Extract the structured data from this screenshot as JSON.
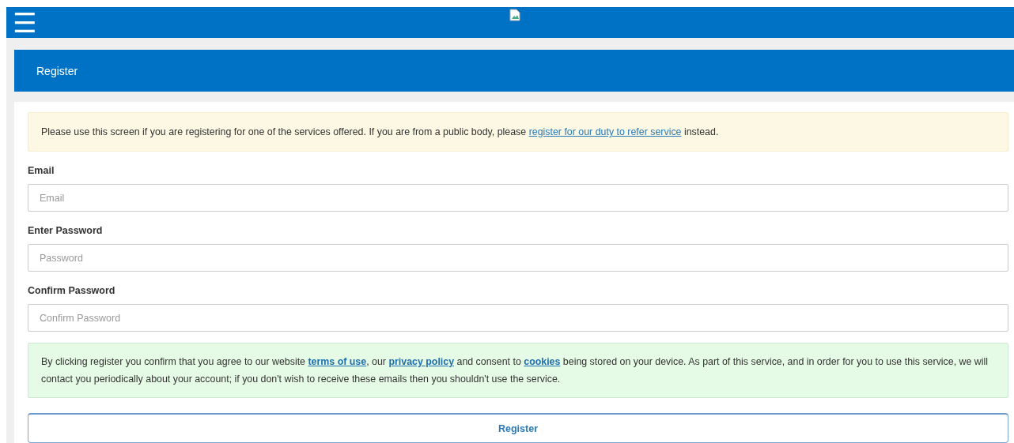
{
  "header": {
    "menu": "☰"
  },
  "panel": {
    "title": "Register"
  },
  "notice": {
    "before": "Please use this screen if you are registering for one of the services offered. If you are from a public body, please ",
    "link": "register for our duty to refer service",
    "after": " instead."
  },
  "fields": [
    {
      "label": "Email",
      "placeholder": "Email"
    },
    {
      "label": "Enter Password",
      "placeholder": "Password"
    },
    {
      "label": "Confirm Password",
      "placeholder": "Confirm Password"
    }
  ],
  "consent": [
    {
      "kind": "text",
      "text": "By clicking register you confirm that you agree to our website "
    },
    {
      "kind": "link",
      "text": "terms of use"
    },
    {
      "kind": "text",
      "text": ", our "
    },
    {
      "kind": "link",
      "text": "privacy policy"
    },
    {
      "kind": "text",
      "text": " and consent to "
    },
    {
      "kind": "link",
      "text": "cookies"
    },
    {
      "kind": "text",
      "text": " being stored on your device. As part of this service, and in order for you to use this service, we will contact you periodically about your account; if you don't wish to receive these emails then you shouldn't use the service."
    }
  ],
  "submit": "Register"
}
